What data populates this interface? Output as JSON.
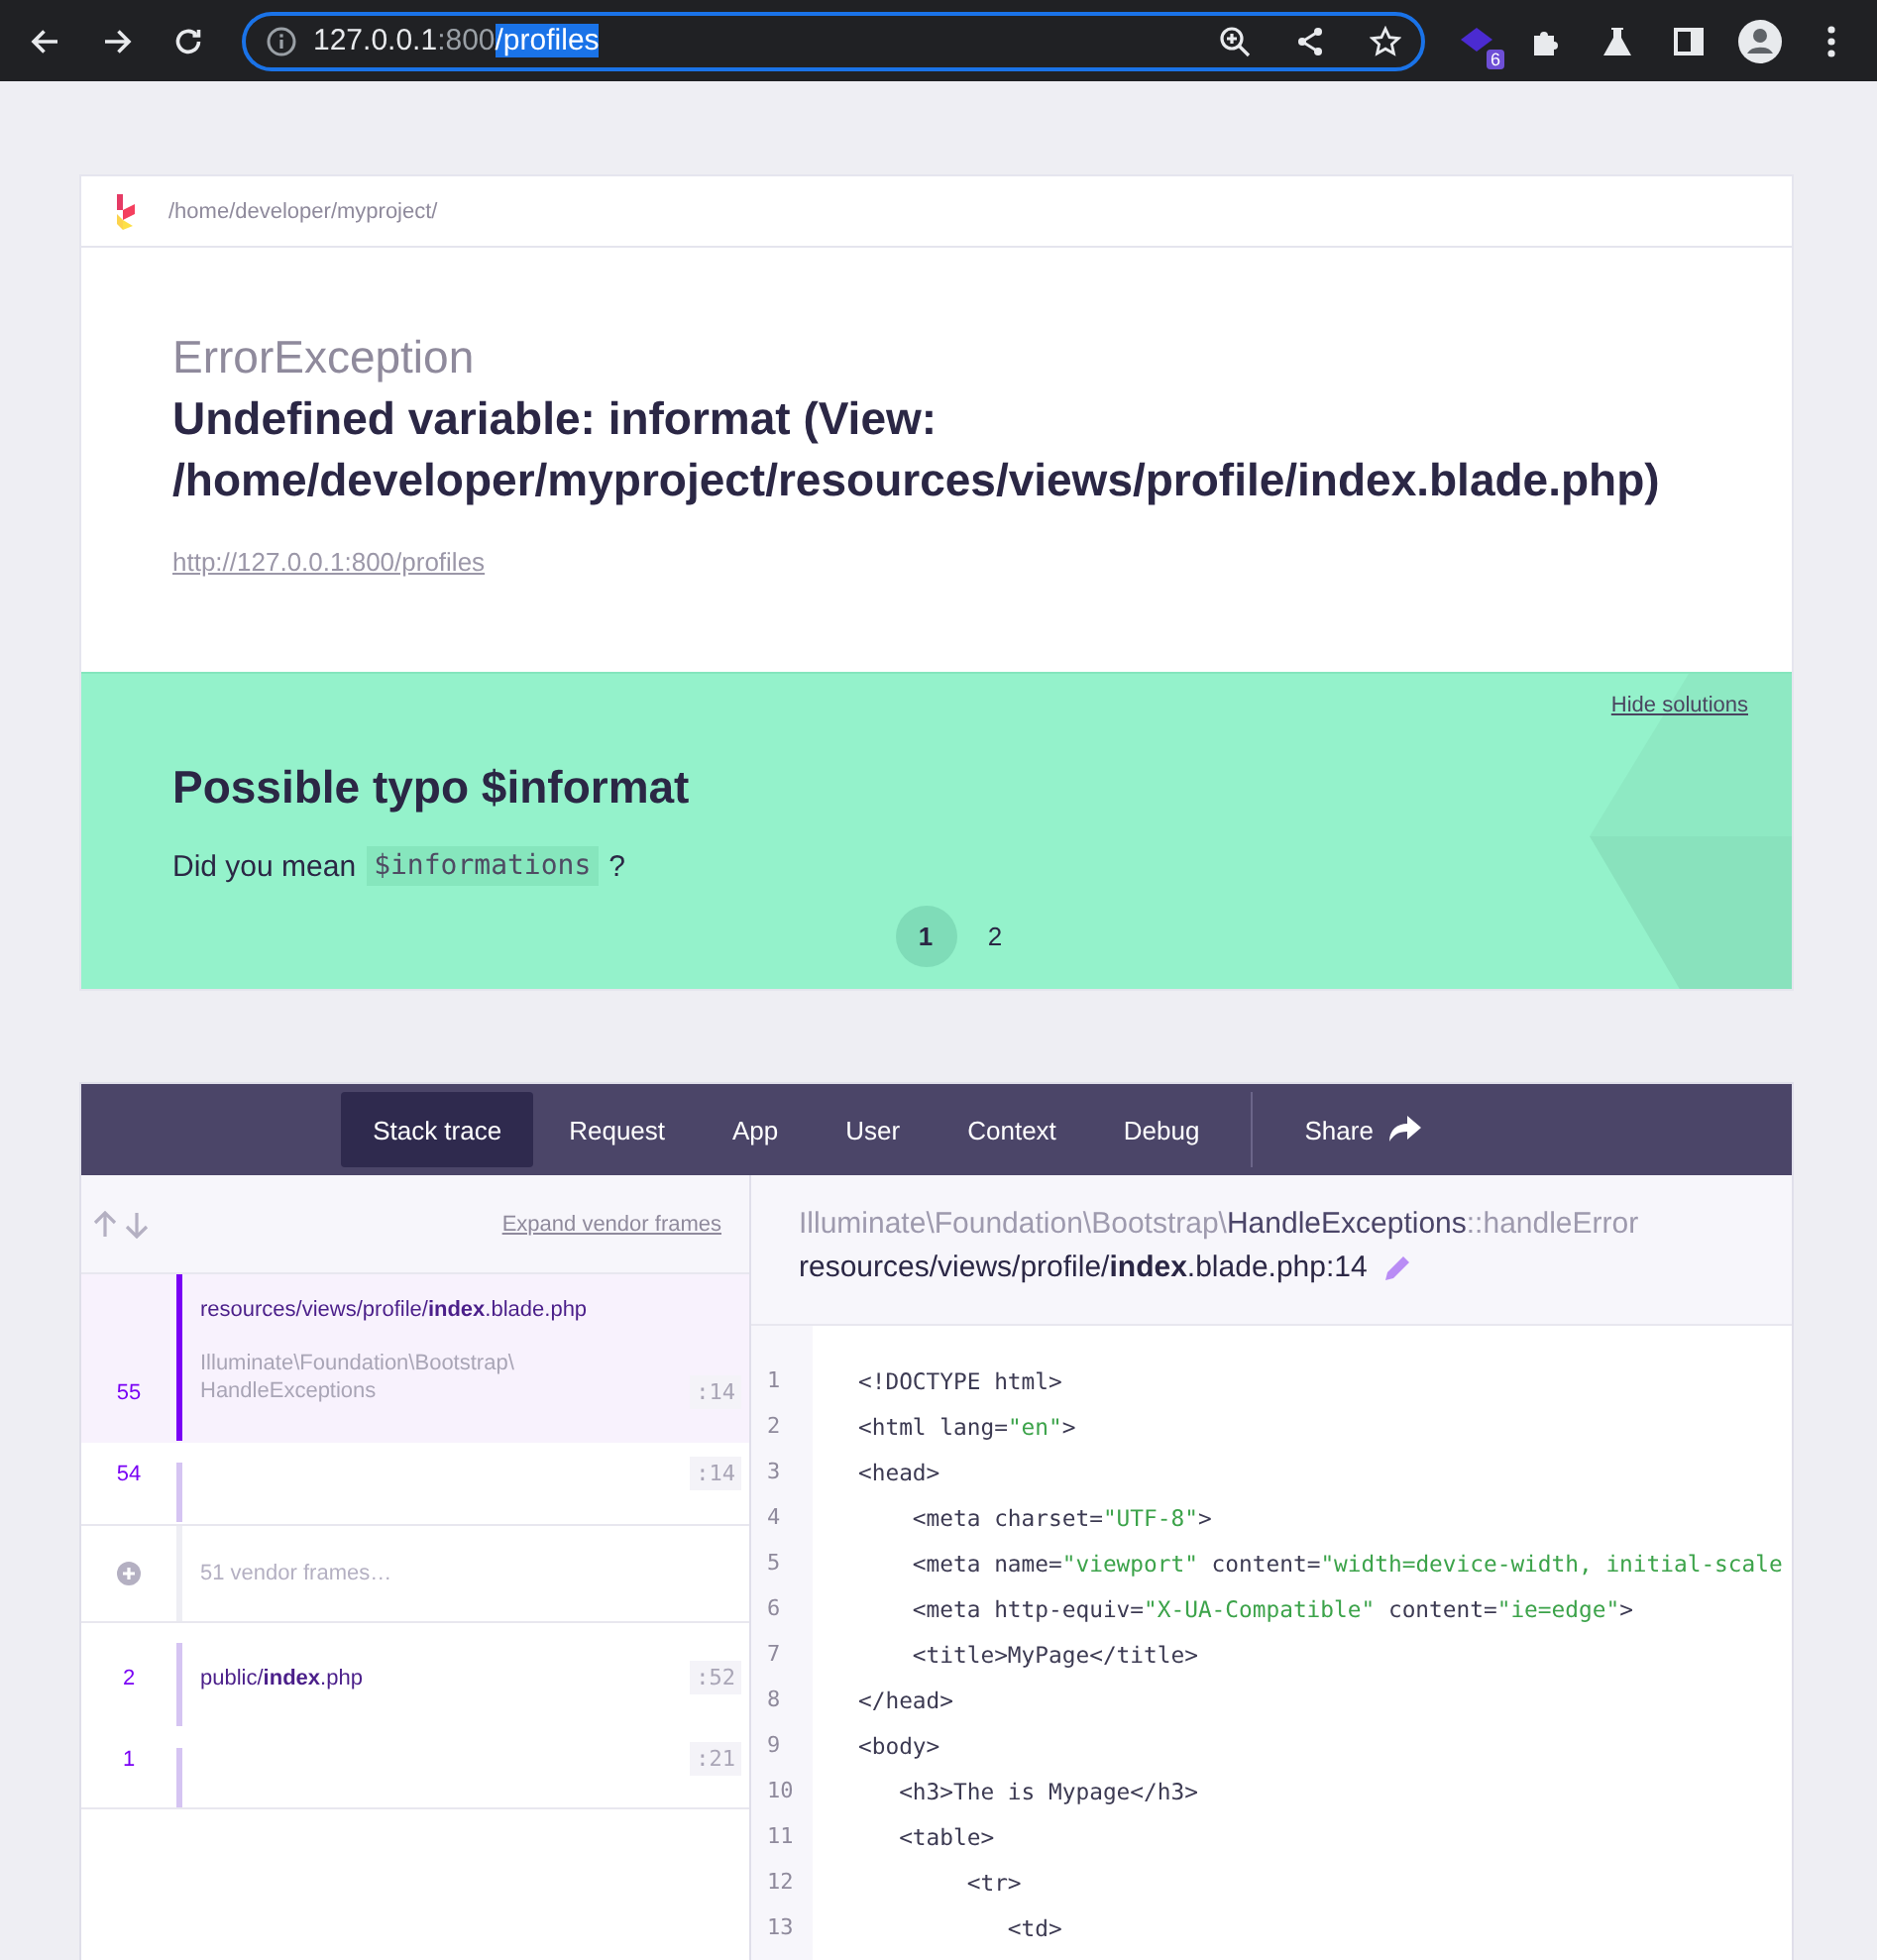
{
  "browser": {
    "host": "127.0.0.1",
    "port": ":800",
    "path": "/profiles",
    "extension_badge": "6"
  },
  "header": {
    "path": "/home/developer/myproject/"
  },
  "error": {
    "type": "ErrorException",
    "message": "Undefined variable: informat (View: /home/developer/myproject/resources/views/profile/index.blade.php)",
    "url": "http://127.0.0.1:800/profiles"
  },
  "solution": {
    "hide_label": "Hide solutions",
    "title": "Possible typo $informat",
    "text_before": "Did you mean",
    "code": "$informations",
    "text_after": "?",
    "pages": [
      {
        "label": "1",
        "selected": true
      },
      {
        "label": "2",
        "selected": false
      }
    ]
  },
  "tabs": [
    {
      "label": "Stack trace",
      "selected": true
    },
    {
      "label": "Request",
      "selected": false
    },
    {
      "label": "App",
      "selected": false
    },
    {
      "label": "User",
      "selected": false
    },
    {
      "label": "Context",
      "selected": false
    },
    {
      "label": "Debug",
      "selected": false
    }
  ],
  "share_label": "Share",
  "frames": {
    "expand_label": "Expand vendor frames",
    "items": [
      {
        "kind": "app",
        "number": "55",
        "file": "resources/views/profile/**index**.blade.php",
        "class": "Illuminate\\Foundation\\Bootstrap\\ HandleExceptions",
        "line": ":14",
        "selected": true
      },
      {
        "kind": "app",
        "number": "54",
        "line": ":14",
        "selected": false
      },
      {
        "kind": "vendor",
        "label": "51 vendor frames…"
      },
      {
        "kind": "app",
        "number": "2",
        "file": "public/**index**.php",
        "line": ":52",
        "selected": false
      },
      {
        "kind": "app",
        "number": "1",
        "line": ":21",
        "selected": false
      }
    ]
  },
  "code": {
    "namespace": "Illuminate\\Foundation\\Bootstrap\\",
    "class": "HandleExceptions",
    "method": "::handleError",
    "file": "resources/views/profile/**index**.blade.php:14",
    "lines": [
      {
        "number": "1",
        "tokens": [
          {
            "kind": "tag",
            "text": "<!DOCTYPE html>"
          }
        ]
      },
      {
        "number": "2",
        "tokens": [
          {
            "kind": "tag",
            "text": "<html lang="
          },
          {
            "kind": "string",
            "text": "\"en\""
          },
          {
            "kind": "tag",
            "text": ">"
          }
        ]
      },
      {
        "number": "3",
        "tokens": [
          {
            "kind": "tag",
            "text": "<head>"
          }
        ]
      },
      {
        "number": "4",
        "tokens": [
          {
            "kind": "tag",
            "text": "    <meta charset="
          },
          {
            "kind": "string",
            "text": "\"UTF-8\""
          },
          {
            "kind": "tag",
            "text": ">"
          }
        ]
      },
      {
        "number": "5",
        "tokens": [
          {
            "kind": "tag",
            "text": "    <meta name="
          },
          {
            "kind": "string",
            "text": "\"viewport\""
          },
          {
            "kind": "tag",
            "text": " content="
          },
          {
            "kind": "string",
            "text": "\"width=device-width, initial-scale"
          }
        ]
      },
      {
        "number": "6",
        "tokens": [
          {
            "kind": "tag",
            "text": "    <meta http-equiv="
          },
          {
            "kind": "string",
            "text": "\"X-UA-Compatible\""
          },
          {
            "kind": "tag",
            "text": " content="
          },
          {
            "kind": "string",
            "text": "\"ie=edge\""
          },
          {
            "kind": "tag",
            "text": ">"
          }
        ]
      },
      {
        "number": "7",
        "tokens": [
          {
            "kind": "tag",
            "text": "    <title>MyPage</title>"
          }
        ]
      },
      {
        "number": "8",
        "tokens": [
          {
            "kind": "tag",
            "text": "</head>"
          }
        ]
      },
      {
        "number": "9",
        "tokens": [
          {
            "kind": "tag",
            "text": "<body>"
          }
        ]
      },
      {
        "number": "10",
        "tokens": [
          {
            "kind": "tag",
            "text": "   <h3>The is Mypage</h3>"
          }
        ]
      },
      {
        "number": "11",
        "tokens": [
          {
            "kind": "tag",
            "text": "   <table>"
          }
        ]
      },
      {
        "number": "12",
        "tokens": [
          {
            "kind": "tag",
            "text": "        <tr>"
          }
        ]
      },
      {
        "number": "13",
        "tokens": [
          {
            "kind": "tag",
            "text": "           <td>"
          }
        ]
      }
    ]
  }
}
